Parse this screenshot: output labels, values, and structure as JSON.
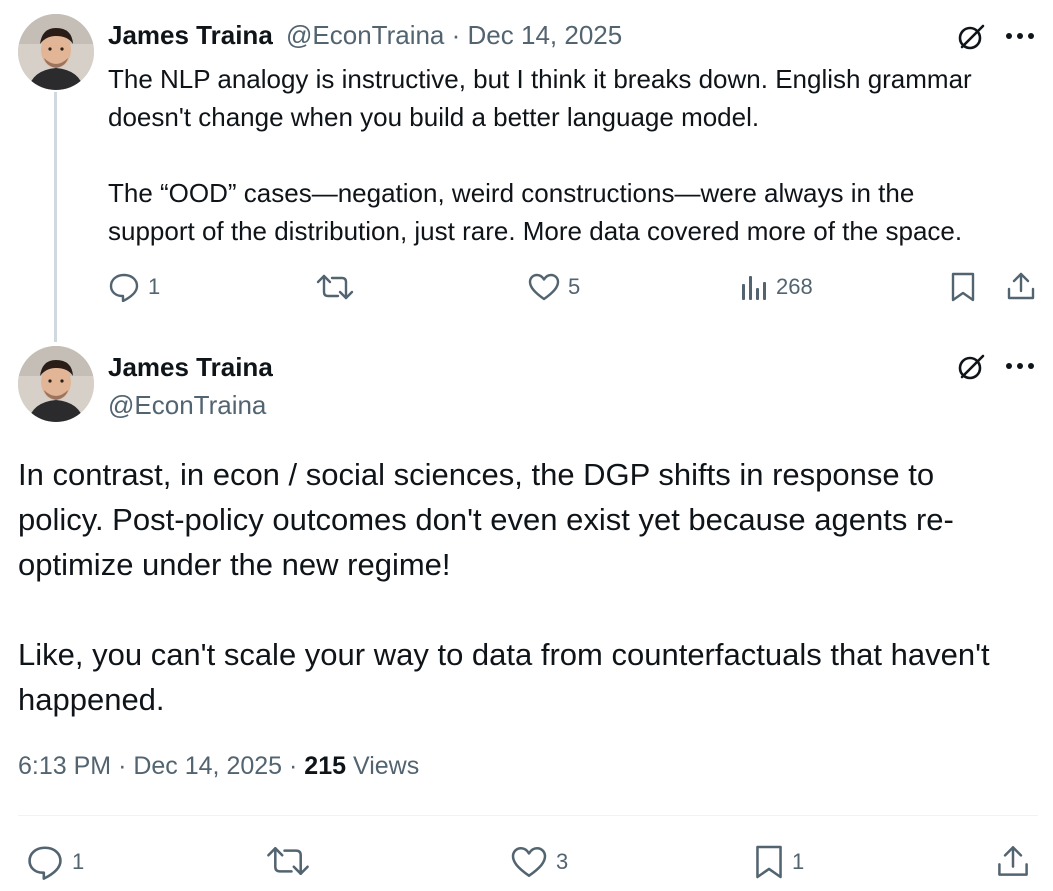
{
  "reply": {
    "author_name": "James Traina",
    "handle": "@EconTraina",
    "separator": "·",
    "date": "Dec 14, 2025",
    "lines": [
      "The NLP analogy is instructive, but I think it breaks down. English grammar",
      "doesn't change when you build a better language model.",
      "The “OOD” cases—negation, weird constructions—were always in the",
      "support of the distribution, just rare. More data covered more of the space."
    ],
    "actions": {
      "replies": "1",
      "reposts": "",
      "likes": "5",
      "views": "268"
    }
  },
  "main_tweet": {
    "author_name": "James Traina",
    "handle": "@EconTraina",
    "lines": [
      "In contrast, in econ / social sciences, the DGP shifts in response to",
      "policy. Post-policy outcomes don't even exist yet because agents re-",
      "optimize under the new regime!",
      "Like, you can't scale your way to data from counterfactuals that haven't",
      "happened."
    ],
    "time": "6:13 PM",
    "separator": "·",
    "date": "Dec 14, 2025",
    "views_count": "215",
    "views_label": "Views",
    "actions": {
      "replies": "1",
      "reposts": "",
      "likes": "3",
      "bookmarks": "1"
    }
  },
  "colors": {
    "text_primary": "#0f1419",
    "text_secondary": "#536471",
    "thread_line": "#cfd9de",
    "divider": "#eff3f4"
  },
  "icons": [
    "grok-icon",
    "more-icon",
    "reply-icon",
    "repost-icon",
    "like-icon",
    "views-icon",
    "bookmark-icon",
    "share-icon"
  ]
}
